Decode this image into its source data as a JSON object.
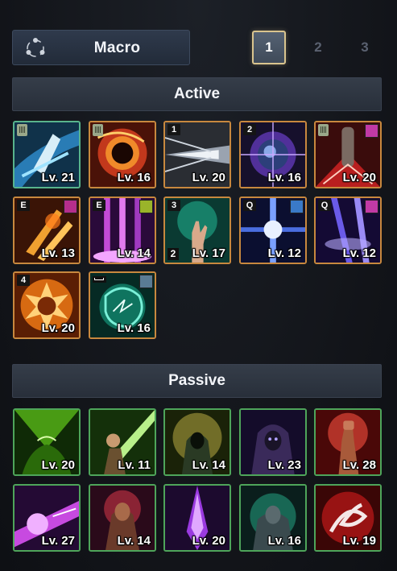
{
  "header": {
    "macro_label": "Macro",
    "pages": [
      {
        "label": "1",
        "active": true
      },
      {
        "label": "2",
        "active": false
      },
      {
        "label": "3",
        "active": false
      }
    ]
  },
  "active": {
    "title": "Active",
    "skills": [
      {
        "level": "Lv. 21",
        "key": "hand-icon",
        "selected": true
      },
      {
        "level": "Lv. 16",
        "key": "hand-icon"
      },
      {
        "level": "Lv. 20",
        "key": "1"
      },
      {
        "level": "Lv. 16",
        "key": "2"
      },
      {
        "level": "Lv. 20",
        "key": "hand-icon",
        "rune": "pink"
      },
      {
        "level": "Lv. 13",
        "key": "E",
        "rune": "pink"
      },
      {
        "level": "Lv. 14",
        "key": "E",
        "rune": "green"
      },
      {
        "level": "Lv. 17",
        "key": "3",
        "key2": "2"
      },
      {
        "level": "Lv. 12",
        "key": "Q",
        "rune": "blue"
      },
      {
        "level": "Lv. 12",
        "key": "Q",
        "rune": "pink"
      },
      {
        "level": "Lv. 20",
        "key": "4"
      },
      {
        "level": "Lv. 16",
        "key": "space-icon",
        "rune": "grey"
      }
    ]
  },
  "passive": {
    "title": "Passive",
    "skills": [
      {
        "level": "Lv. 20"
      },
      {
        "level": "Lv. 11"
      },
      {
        "level": "Lv. 14"
      },
      {
        "level": "Lv. 23"
      },
      {
        "level": "Lv. 28"
      },
      {
        "level": "Lv. 27"
      },
      {
        "level": "Lv. 14"
      },
      {
        "level": "Lv. 20"
      },
      {
        "level": "Lv. 16"
      },
      {
        "level": "Lv. 19"
      }
    ]
  },
  "colors": {
    "active_border": "#c8883e",
    "passive_border": "#4ea55a",
    "selected_border": "#58b48c",
    "page_active_border": "#d9c48e"
  }
}
